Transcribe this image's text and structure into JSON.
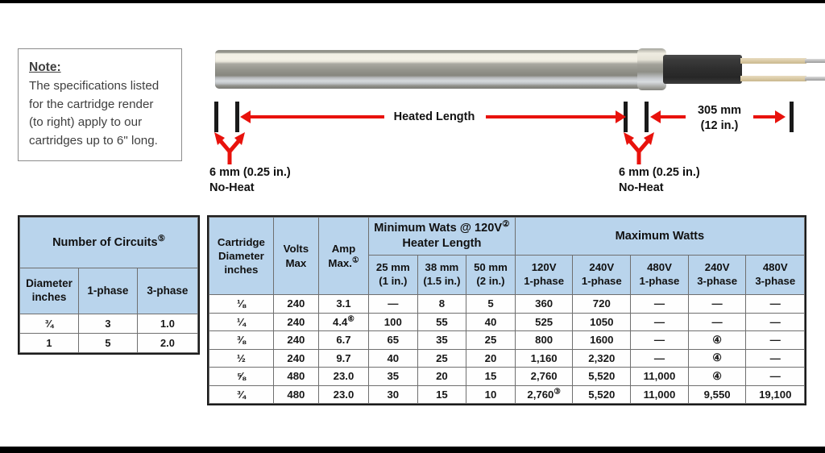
{
  "note": {
    "title": "Note:",
    "lines": [
      "The specifications listed",
      "for the cartridge render",
      "(to right) apply to our",
      "cartridges up to 6\" long."
    ]
  },
  "diagram": {
    "heated_length_label": "Heated Length",
    "lead_length_label_mm": "305 mm",
    "lead_length_label_in": "(12 in.)",
    "noheat_left_line1": "6 mm (0.25 in.)",
    "noheat_left_line2": "No-Heat",
    "noheat_right_line1": "6 mm (0.25 in.)",
    "noheat_right_line2": "No-Heat",
    "accent_color": "#e8120c",
    "body_color": "#8e8e86",
    "cable_color": "#2e2e2e",
    "lead_color": "#d9c9a3"
  },
  "circuits_table": {
    "title": "Number of Circuits",
    "title_superscript": "⓪5",
    "columns": [
      "Diameter inches",
      "1-phase",
      "3-phase"
    ],
    "col_diameter_line1": "Diameter",
    "col_diameter_line2": "inches",
    "rows": [
      {
        "diameter": "¾",
        "one_phase": "3",
        "three_phase": "1.0"
      },
      {
        "diameter": "1",
        "one_phase": "5",
        "three_phase": "2.0"
      }
    ]
  },
  "specs_table": {
    "group_headers": {
      "cartridge_diameter_l1": "Cartridge",
      "cartridge_diameter_l2": "Diameter",
      "cartridge_diameter_l3": "inches",
      "volts_l1": "Volts",
      "volts_l2": "Max",
      "amp_l1": "Amp",
      "amp_l2": "Max.",
      "amp_sup": "①",
      "min_watts_l1": "Minimum Wats @ 120V",
      "min_watts_sup": "②",
      "min_watts_l2": "Heater Length",
      "max_watts": "Maximum Watts"
    },
    "sub_headers": {
      "len_25_l1": "25 mm",
      "len_25_l2": "(1 in.)",
      "len_38_l1": "38 mm",
      "len_38_l2": "(1.5 in.)",
      "len_50_l1": "50 mm",
      "len_50_l2": "(2 in.)",
      "mw_120_l1": "120V",
      "mw_120_l2": "1-phase",
      "mw_240_1_l1": "240V",
      "mw_240_1_l2": "1-phase",
      "mw_480_1_l1": "480V",
      "mw_480_1_l2": "1-phase",
      "mw_240_3_l1": "240V",
      "mw_240_3_l2": "3-phase",
      "mw_480_3_l1": "480V",
      "mw_480_3_l2": "3-phase"
    },
    "rows": [
      {
        "diameter": "⅛",
        "volts": "240",
        "amp": "3.1",
        "amp_sup": "",
        "w25": "—",
        "w38": "8",
        "w50": "5",
        "mw120": "360",
        "mw120_sup": "",
        "mw240_1": "720",
        "mw480_1": "—",
        "mw240_3": "—",
        "mw480_3": "—"
      },
      {
        "diameter": "¼",
        "volts": "240",
        "amp": "4.4",
        "amp_sup": "⑥",
        "w25": "100",
        "w38": "55",
        "w50": "40",
        "mw120": "525",
        "mw120_sup": "",
        "mw240_1": "1050",
        "mw480_1": "—",
        "mw240_3": "—",
        "mw480_3": "—"
      },
      {
        "diameter": "⅜",
        "volts": "240",
        "amp": "6.7",
        "amp_sup": "",
        "w25": "65",
        "w38": "35",
        "w50": "25",
        "mw120": "800",
        "mw120_sup": "",
        "mw240_1": "1600",
        "mw480_1": "—",
        "mw240_3": "④",
        "mw480_3": "—"
      },
      {
        "diameter": "½",
        "volts": "240",
        "amp": "9.7",
        "amp_sup": "",
        "w25": "40",
        "w38": "25",
        "w50": "20",
        "mw120": "1,160",
        "mw120_sup": "",
        "mw240_1": "2,320",
        "mw480_1": "—",
        "mw240_3": "④",
        "mw480_3": "—"
      },
      {
        "diameter": "⅝",
        "volts": "480",
        "amp": "23.0",
        "amp_sup": "",
        "w25": "35",
        "w38": "20",
        "w50": "15",
        "mw120": "2,760",
        "mw120_sup": "",
        "mw240_1": "5,520",
        "mw480_1": "11,000",
        "mw240_3": "④",
        "mw480_3": "—"
      },
      {
        "diameter": "¾",
        "volts": "480",
        "amp": "23.0",
        "amp_sup": "",
        "w25": "30",
        "w38": "15",
        "w50": "10",
        "mw120": "2,760",
        "mw120_sup": "③",
        "mw240_1": "5,520",
        "mw480_1": "11,000",
        "mw240_3": "9,550",
        "mw480_3": "19,100"
      }
    ]
  }
}
